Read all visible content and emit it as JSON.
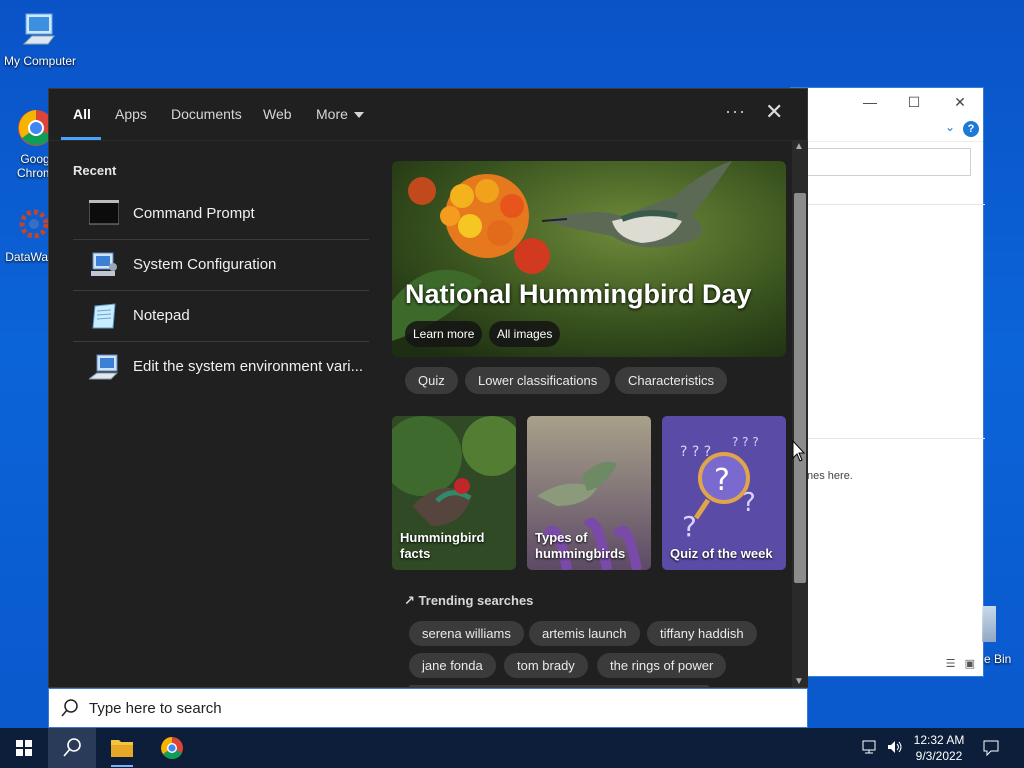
{
  "desktop": {
    "icons": [
      {
        "label": "My Computer"
      },
      {
        "label": "Goog Chrom"
      },
      {
        "label": "DataWag"
      }
    ],
    "recycle_bin_partial": "e Bin"
  },
  "explorer": {
    "empty_text": "nes here."
  },
  "search_panel": {
    "tabs": [
      "All",
      "Apps",
      "Documents",
      "Web",
      "More"
    ],
    "recent_heading": "Recent",
    "recent_items": [
      {
        "label": "Command Prompt",
        "icon": "cmd-icon"
      },
      {
        "label": "System Configuration",
        "icon": "msconfig-icon"
      },
      {
        "label": "Notepad",
        "icon": "notepad-icon"
      },
      {
        "label": "Edit the system environment vari...",
        "icon": "sysprop-icon"
      }
    ],
    "hero": {
      "title": "National Hummingbird Day",
      "learn_more": "Learn more",
      "all_images": "All images"
    },
    "chips": [
      "Quiz",
      "Lower classifications",
      "Characteristics"
    ],
    "cards": [
      {
        "label_line1": "Hummingbird",
        "label_line2": "facts"
      },
      {
        "label_line1": "Types of",
        "label_line2": "hummingbirds"
      },
      {
        "label_line1": "Quiz of the week",
        "label_line2": ""
      }
    ],
    "trending_heading": "Trending searches",
    "trending_row1": [
      "serena williams",
      "artemis launch",
      "tiffany haddish"
    ],
    "trending_row2": [
      "jane fonda",
      "tom brady",
      "the rings of power"
    ]
  },
  "search_box": {
    "placeholder": "Type here to search"
  },
  "taskbar": {
    "time": "12:32 AM",
    "date": "9/3/2022"
  },
  "colors": {
    "accent": "#4aa3ff",
    "panel_bg": "#202020",
    "desktop_bg": "#0b64d8"
  }
}
